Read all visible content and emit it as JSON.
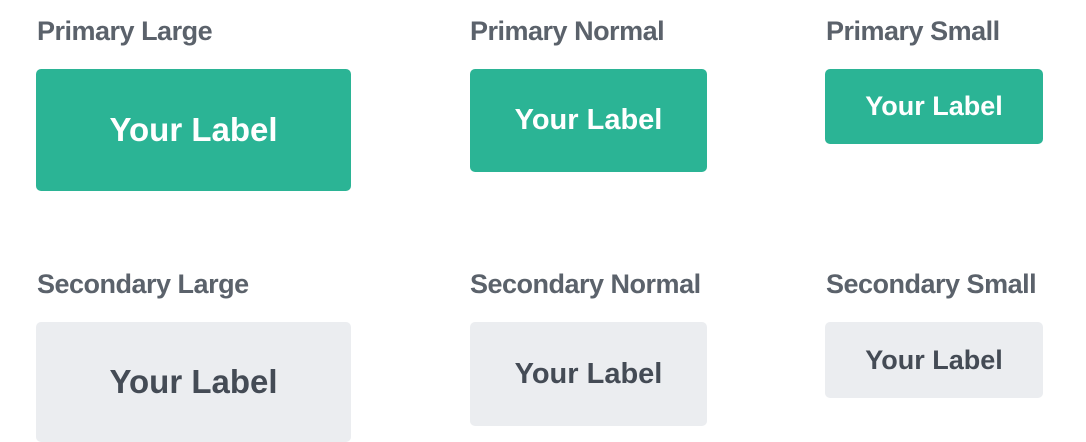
{
  "colors": {
    "primary_bg": "#2bb495",
    "primary_text": "#ffffff",
    "secondary_bg": "#ebedf0",
    "secondary_text": "#444b55",
    "heading_text": "#5b626b"
  },
  "primary": {
    "large": {
      "heading": "Primary Large",
      "button_label": "Your Label"
    },
    "normal": {
      "heading": "Primary Normal",
      "button_label": "Your Label"
    },
    "small": {
      "heading": "Primary Small",
      "button_label": "Your Label"
    }
  },
  "secondary": {
    "large": {
      "heading": "Secondary Large",
      "button_label": "Your Label"
    },
    "normal": {
      "heading": "Secondary Normal",
      "button_label": "Your Label"
    },
    "small": {
      "heading": "Secondary Small",
      "button_label": "Your Label"
    }
  }
}
